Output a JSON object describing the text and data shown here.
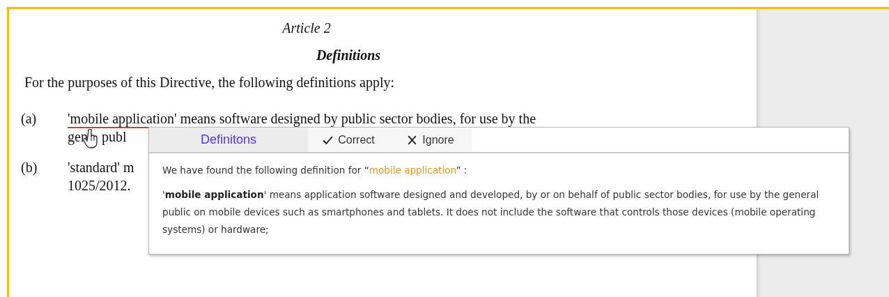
{
  "document": {
    "article": "Article 2",
    "heading": "Definitions",
    "intro": "For the purposes of this Directive, the following definitions apply:",
    "items": [
      {
        "marker": "(a)",
        "lines": [
          {
            "term": "'mobile application'",
            "text": " means software designed by public sector bodies, for use by the"
          },
          {
            "text": "gen",
            "after_cursor": "publ"
          }
        ]
      },
      {
        "marker": "(b)",
        "lines": [
          {
            "text": "'standard' m"
          },
          {
            "text": "1025/2012."
          }
        ]
      }
    ]
  },
  "popup": {
    "tabs": [
      {
        "label": "Definitons",
        "selected": true
      }
    ],
    "actions": [
      {
        "kind": "check",
        "label": "Correct"
      },
      {
        "kind": "cross",
        "label": "Ignore"
      }
    ],
    "intro_prefix": "We have found the following definition for “",
    "intro_term": "mobile application",
    "intro_suffix": "” :",
    "definition": "'**mobile application**' means application software designed and developed, by or on behalf of public sector bodies, for use by the general public on mobile devices such as smartphones and tablets. It does not include the software that controls those devices (mobile operating systems) or hardware;"
  }
}
